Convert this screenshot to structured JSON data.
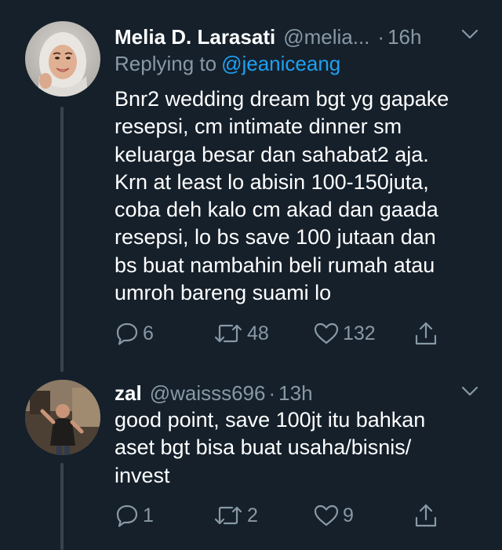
{
  "tweets": [
    {
      "display_name": "Melia D. Larasati",
      "handle": "@melia...",
      "dot": "·",
      "time": "16h",
      "reply_prefix": "Replying to",
      "reply_to": "@jeaniceang",
      "text": "Bnr2 wedding dream bgt yg gapake\nresepsi, cm intimate dinner sm\nkeluarga besar dan sahabat2 aja.\nKrn at least lo abisin 100-150juta,\ncoba deh kalo cm akad dan gaada\nresepsi, lo bs save 100 jutaan dan\nbs buat nambahin beli rumah atau\numroh bareng suami lo",
      "replies": "6",
      "retweets": "48",
      "likes": "132"
    },
    {
      "display_name": "zal",
      "handle": "@waisss696",
      "dot": "·",
      "time": "13h",
      "text": "good point, save 100jt itu bahkan\naset bgt bisa buat usaha/bisnis/\ninvest",
      "replies": "1",
      "retweets": "2",
      "likes": "9"
    }
  ],
  "icons": {
    "reply": "comment-bubble-icon",
    "retweet": "retweet-arrows-icon",
    "like": "heart-icon",
    "share": "share-upload-icon",
    "caret": "chevron-down-icon"
  },
  "colors": {
    "background": "#15202b",
    "primary_text": "#ffffff",
    "secondary_text": "#8899a6",
    "link": "#1da1f2",
    "thread_line": "#38444d"
  }
}
